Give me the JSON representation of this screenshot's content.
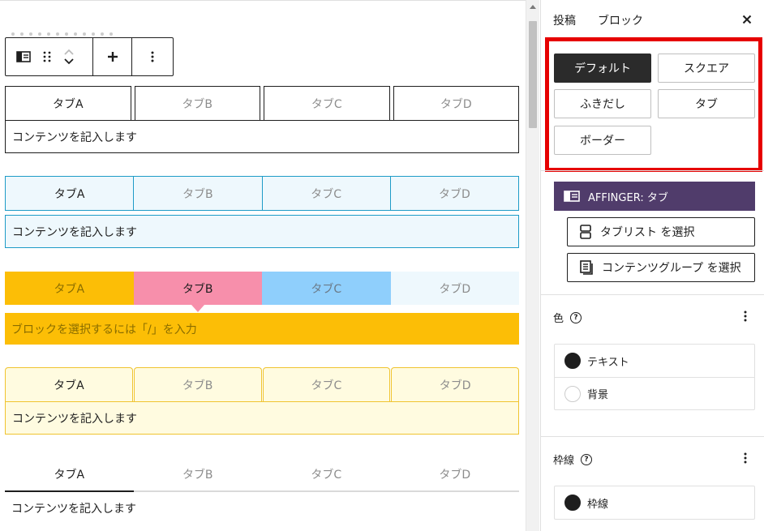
{
  "editor": {
    "toolbar": {
      "block_type_icon": "tabs-block-icon",
      "drag_icon": "drag-handle-icon",
      "move_up_icon": "chevron-up-icon",
      "move_down_icon": "chevron-down-icon",
      "add_icon": "plus-icon",
      "options_icon": "more-vertical-icon"
    },
    "blocks": [
      {
        "style": "default",
        "tabs": [
          "タブA",
          "タブB",
          "タブC",
          "タブD"
        ],
        "active": 0,
        "content": "コンテンツを記入します"
      },
      {
        "style": "square",
        "tabs": [
          "タブA",
          "タブB",
          "タブC",
          "タブD"
        ],
        "active": 0,
        "content": "コンテンツを記入します"
      },
      {
        "style": "fukidashi",
        "tabs": [
          "タブA",
          "タブB",
          "タブC",
          "タブD"
        ],
        "active": 1,
        "content": "ブロックを選択するには「/」を入力"
      },
      {
        "style": "tab",
        "tabs": [
          "タブA",
          "タブB",
          "タブC",
          "タブD"
        ],
        "active": 0,
        "content": "コンテンツを記入します"
      },
      {
        "style": "border",
        "tabs": [
          "タブA",
          "タブB",
          "タブC",
          "タブD"
        ],
        "active": 0,
        "content": "コンテンツを記入します"
      }
    ]
  },
  "sidebar": {
    "tabs": [
      "投稿",
      "ブロック"
    ],
    "close_icon": "close-icon",
    "styles": {
      "buttons": [
        "デフォルト",
        "スクエア",
        "ふきだし",
        "タブ",
        "ボーダー"
      ],
      "selected": "デフォルト",
      "highlight_color": "#e60000"
    },
    "block_card": {
      "title": "AFFINGER: タブ",
      "icon": "tabs-block-icon",
      "color": "#503c6b"
    },
    "select_tablist": "タブリスト を選択",
    "select_content": "コンテンツグループ を選択",
    "color_section": {
      "title": "色",
      "items": [
        {
          "label": "テキスト",
          "swatch": "#1e1e1e"
        },
        {
          "label": "背景",
          "swatch": "none"
        }
      ]
    },
    "border_section": {
      "title": "枠線",
      "items": [
        {
          "label": "枠線",
          "swatch": "#1e1e1e"
        }
      ]
    }
  },
  "colors": {
    "square_border": "#1e9bc7",
    "square_bg": "#eef8fd",
    "fukidashi_a": "#fcbe06",
    "fukidashi_b": "#f78fab",
    "fukidashi_c": "#8fcffc",
    "tab_border": "#f0c430",
    "tab_bg": "#fffbe0"
  }
}
